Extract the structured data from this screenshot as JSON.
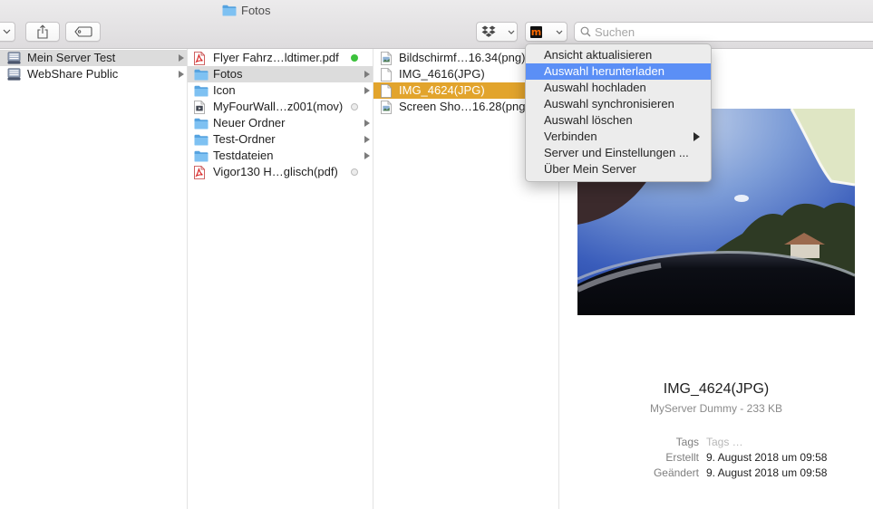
{
  "window": {
    "title": "Fotos",
    "title_icon": "folder-icon"
  },
  "toolbar": {
    "view_options_icon": "chevron-down-icon",
    "share_icon": "share-icon",
    "tag_icon": "tag-icon",
    "dropbox_icon": "dropbox-icon",
    "app_menu_logo": "m",
    "search_icon": "search-icon",
    "search_placeholder": "Suchen",
    "search_value": ""
  },
  "columns": {
    "servers": [
      {
        "label": "Mein Server Test",
        "icon": "server-icon",
        "selected": true,
        "has_children": true
      },
      {
        "label": "WebShare Public",
        "icon": "server-icon",
        "selected": false,
        "has_children": true
      }
    ],
    "server_contents": [
      {
        "label": "Flyer Fahrz…ldtimer.pdf",
        "icon": "pdf-icon",
        "status_dot": "green"
      },
      {
        "label": "Fotos",
        "icon": "folder-icon",
        "selected": true,
        "has_children": true
      },
      {
        "label": "Icon",
        "icon": "folder-icon",
        "has_children": true
      },
      {
        "label": "MyFourWall…z001(mov)",
        "icon": "video-file-icon",
        "status_dot": "gray"
      },
      {
        "label": "Neuer Ordner",
        "icon": "folder-icon",
        "has_children": true
      },
      {
        "label": "Test-Ordner",
        "icon": "folder-icon",
        "has_children": true
      },
      {
        "label": "Testdateien",
        "icon": "folder-icon",
        "has_children": true
      },
      {
        "label": "Vigor130 H…glisch(pdf)",
        "icon": "pdf-icon",
        "status_dot": "gray"
      }
    ],
    "fotos": [
      {
        "label": "Bildschirmf…16.34(png)",
        "icon": "image-file-icon"
      },
      {
        "label": "IMG_4616(JPG)",
        "icon": "file-icon"
      },
      {
        "label": "IMG_4624(JPG)",
        "icon": "file-icon",
        "selected": true
      },
      {
        "label": "Screen Sho…16.28(png)",
        "icon": "image-file-icon"
      }
    ]
  },
  "menu": {
    "items": [
      {
        "label": "Ansicht aktualisieren"
      },
      {
        "label": "Auswahl herunterladen",
        "highlighted": true
      },
      {
        "label": "Auswahl hochladen"
      },
      {
        "label": "Auswahl synchronisieren"
      },
      {
        "label": "Auswahl löschen"
      },
      {
        "label": "Verbinden",
        "submenu": true
      },
      {
        "label": "Server und Einstellungen ..."
      },
      {
        "label": "Über Mein Server"
      }
    ]
  },
  "preview": {
    "file_name": "IMG_4624(JPG)",
    "subtitle": "MyServer Dummy - 233 KB",
    "tags_label": "Tags",
    "tags_placeholder": "Tags …",
    "created_label": "Erstellt",
    "created_value": "9. August 2018 um 09:58",
    "modified_label": "Geändert",
    "modified_value": "9. August 2018 um 09:58"
  },
  "colors": {
    "selection_inactive": "#dcdcdc",
    "selection_active": "#e2a42c",
    "menu_highlight": "#5b8ff6",
    "folder_blue": "#6bb6ee",
    "status_dot_green": "#3cc23c",
    "status_dot_gray": "#ececec"
  }
}
